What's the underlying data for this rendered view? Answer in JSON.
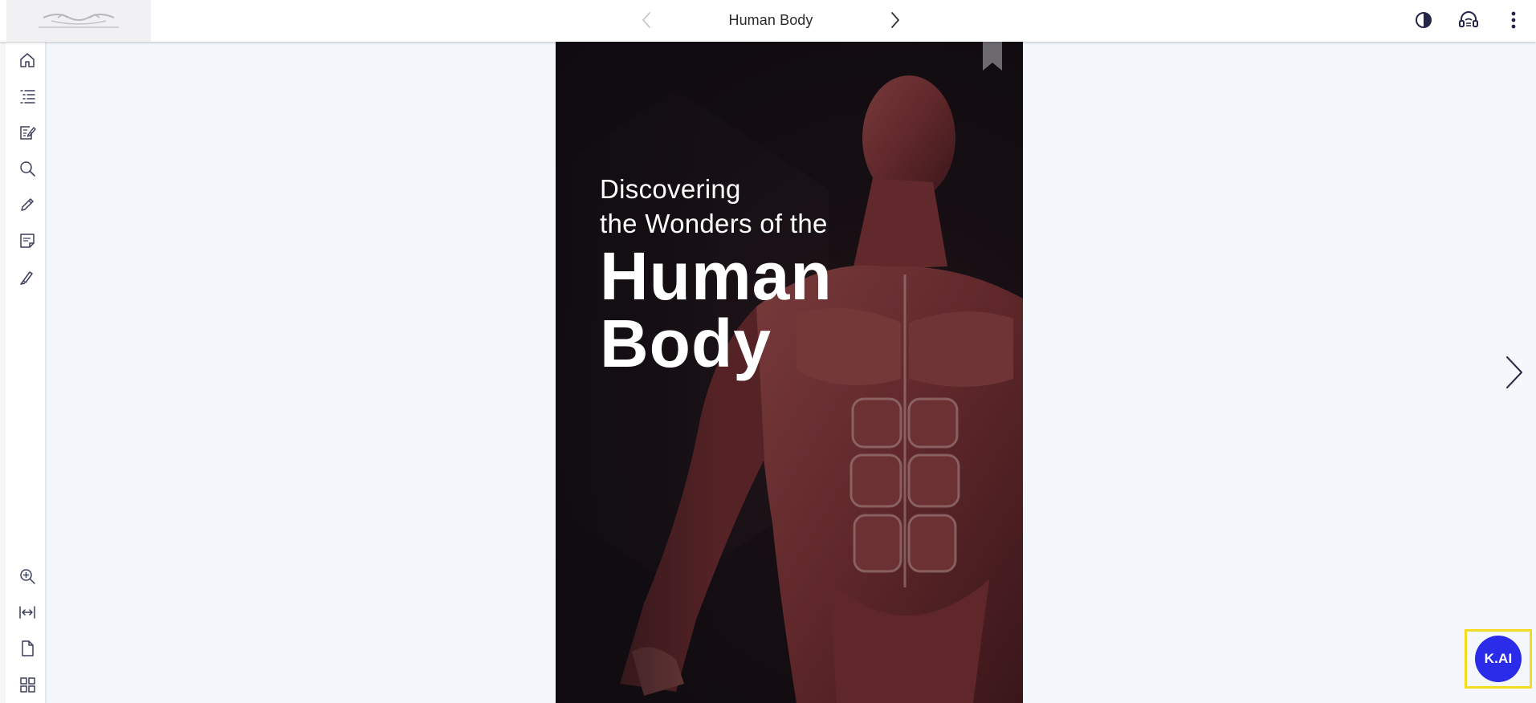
{
  "header": {
    "title": "Human Body",
    "prev_icon": "chevron-left-icon",
    "next_icon": "chevron-right-icon",
    "right_icons": [
      "contrast-icon",
      "reader-headphones-icon",
      "more-vertical-icon"
    ]
  },
  "sidebar": {
    "top_items": [
      {
        "icon": "home-icon"
      },
      {
        "icon": "table-of-contents-icon"
      },
      {
        "icon": "notebook-edit-icon"
      },
      {
        "icon": "search-icon"
      },
      {
        "icon": "pencil-icon"
      },
      {
        "icon": "notes-icon"
      },
      {
        "icon": "highlighter-icon"
      }
    ],
    "bottom_items": [
      {
        "icon": "zoom-in-icon"
      },
      {
        "icon": "fit-width-icon"
      },
      {
        "icon": "single-page-icon"
      },
      {
        "icon": "grid-view-icon"
      }
    ]
  },
  "cover": {
    "line1": "Discovering",
    "line2": "the Wonders of the",
    "line3": "Human",
    "line4": "Body"
  },
  "kai_button": {
    "label": "K.AI"
  },
  "colors": {
    "accent": "#2b2bea",
    "highlight": "#f3dc1e",
    "background": "#f4f7fc",
    "cover_bg": "#1b1218",
    "muscle": "#8a3f42"
  }
}
